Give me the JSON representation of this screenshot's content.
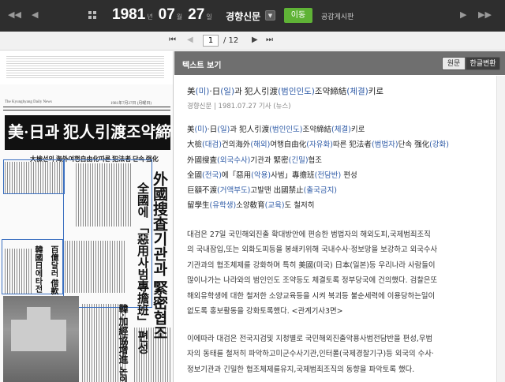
{
  "top": {
    "prev_year": "◀◀",
    "prev_day": "◀",
    "next_day": "▶",
    "next_year": "▶▶",
    "year": "1981",
    "year_unit": "년",
    "month": "07",
    "month_unit": "월",
    "day": "27",
    "day_unit": "일",
    "newspaper": "경향신문",
    "go_label": "이동",
    "board_label": "공감게시판"
  },
  "pager": {
    "current": "1",
    "total": "/ 12"
  },
  "newspaper_image": {
    "masthead_small": "The Kyunghyang Daily News",
    "date_line": "1981年7月27日 (月曜日)",
    "headline": "美·日과 犯人引渡조약締結키로",
    "subhead": "大檢선의 海外여행自由化따른 犯法者 단속 强化",
    "vertical_headline_1": "外國搜査기관과 緊密협조",
    "vertical_headline_2": "全國에 「惡用사범專擔班」 편성",
    "vertical_headline_3": "韓國日에타전",
    "vertical_headline_4": "百億달러 借款",
    "vertical_headline_5": "韓·加經協增進 논의"
  },
  "panel": {
    "title": "텍스트 보기",
    "toggle_original": "원문",
    "toggle_korean": "한글변환"
  },
  "article": {
    "title": "美(미)·日(일)과 犯人引渡(범인인도)조약締結(체결)키로",
    "meta": "경향신문 | 1981.07.27  기사 (뉴스)",
    "summary": [
      "美(미)·日(일)과 犯人引渡(범인인도)조약締結(체결)키로",
      "大檢(대검)건의海外(해외)여행自由化(자유화)따른 犯法者(범법자)단속 强化(강화)",
      "外國搜査(외국수사)기관과 緊密(긴밀)협조",
      "全國(전국)에「惡用(악용)사범」專擔班(전담반) 편성",
      "巨額不渡(거액부도)고발땐 出國禁止(출국금지)",
      "留學生(유학생)소양敎育(교육)도 철저히"
    ],
    "para1": [
      " 대검은 27일 국민해외진출 확대방안에 편승한 범법자의 해외도피,국제범죄조직",
      "의 국내잠입,또는 외화도피등을 봉쇄키위해 국내수사·정보망을 보강하고 외국수사",
      "기관과의 협조체제를 강화하며 특히 美國(미국) 日本(일본)등 우리나라 사람들이",
      "많이나가는 나라와의 범인인도 조약등도 체결토록 정부당국에 건의했다. 검찰은또",
      "해외유학생에 대한 철저한 소양교육등을 시켜 북괴등 불순세력에 이용당하는일이",
      "없도록 홍보활동을 강화토록했다. <관계기사3면>"
    ],
    "para2": [
      " 이에따라 대검은 전국지검및 지청별로 국민해외진출악용사범전담반을 편성,우범",
      "자의 동태를 철저히 파악하고미군수사기관,인터폴(국제경찰기구)등 외국의 수사·",
      "정보기관과 긴밀한 협조체제를유지,국제범죄조직의 동향을 파악토록 했다."
    ]
  }
}
